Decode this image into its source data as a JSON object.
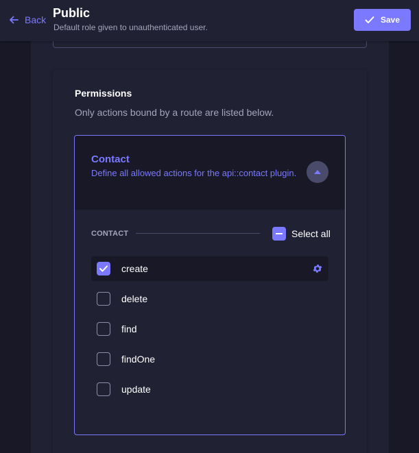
{
  "header": {
    "back_label": "Back",
    "title": "Public",
    "subtitle": "Default role given to unauthenticated user.",
    "save_label": "Save"
  },
  "permissions": {
    "title": "Permissions",
    "description": "Only actions bound by a route are listed below."
  },
  "accordion": {
    "title": "Contact",
    "description": "Define all allowed actions for the api::contact plugin.",
    "expanded": true,
    "section_label": "CONTACT",
    "select_all_label": "Select all",
    "select_all_state": "indeterminate",
    "actions": [
      {
        "label": "create",
        "checked": true,
        "active": true
      },
      {
        "label": "delete",
        "checked": false,
        "active": false
      },
      {
        "label": "find",
        "checked": false,
        "active": false
      },
      {
        "label": "findOne",
        "checked": false,
        "active": false
      },
      {
        "label": "update",
        "checked": false,
        "active": false
      }
    ]
  },
  "colors": {
    "primary": "#7b79ff",
    "background": "#181826",
    "surface": "#212134",
    "muted_text": "#a5a5ba"
  },
  "icons": {
    "back": "arrow-left-icon",
    "save": "check-icon",
    "toggle": "chevron-up-icon",
    "settings": "cog-icon"
  }
}
